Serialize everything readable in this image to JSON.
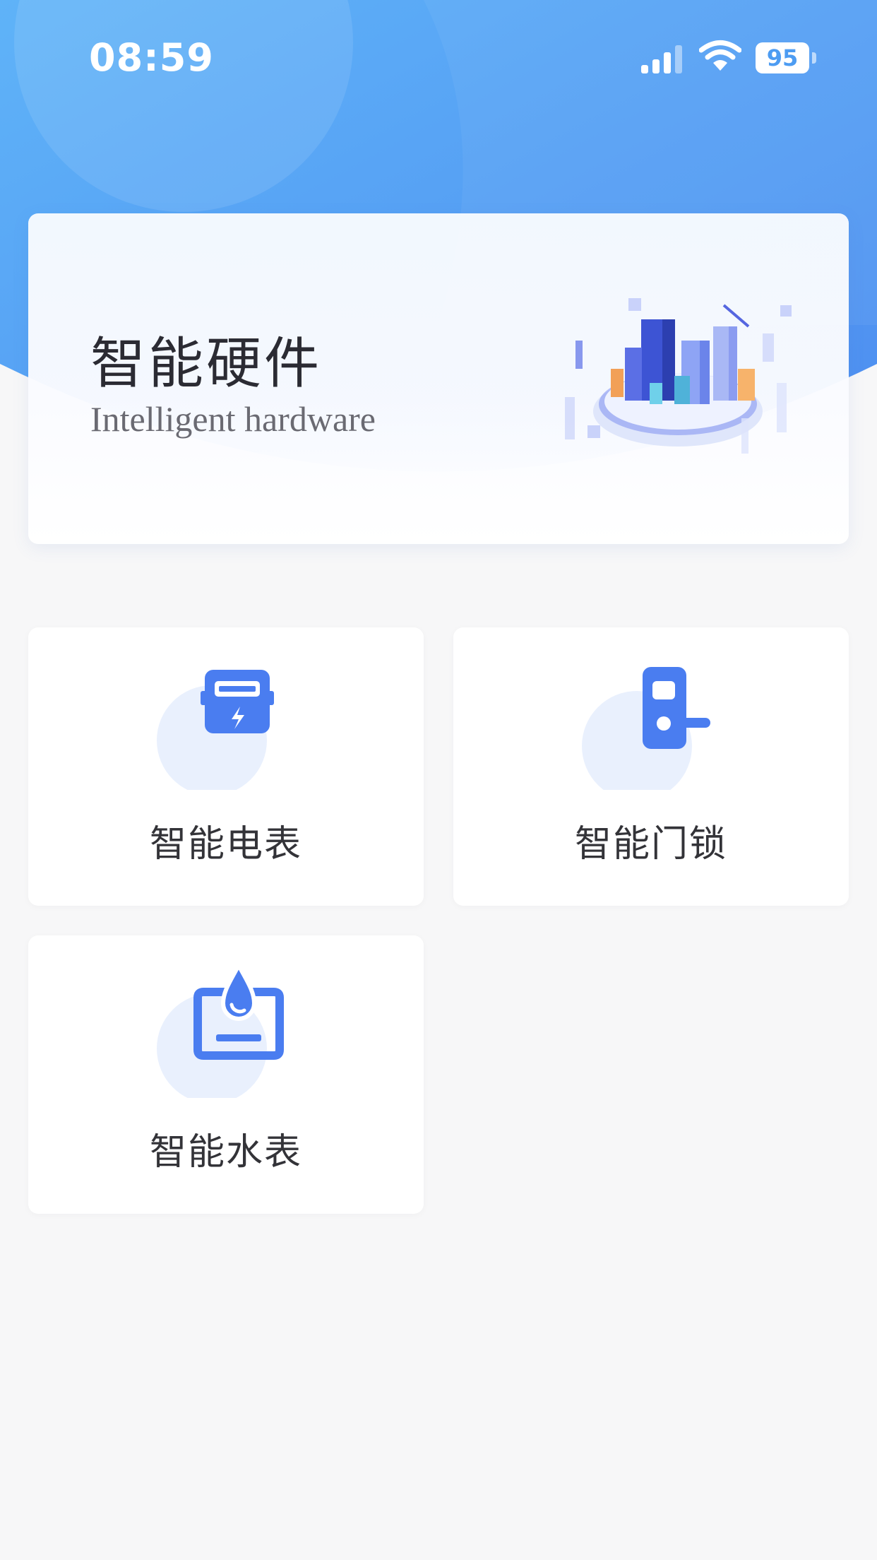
{
  "status_bar": {
    "time": "08:59",
    "battery": "95",
    "signal_icon": "cellular-signal-icon",
    "wifi_icon": "wifi-icon"
  },
  "banner": {
    "title": "智能硬件",
    "subtitle": "Intelligent hardware",
    "illustration": "smart-city-illustration"
  },
  "tiles": [
    {
      "label": "智能电表",
      "icon": "electric-meter-icon"
    },
    {
      "label": "智能门锁",
      "icon": "door-lock-icon"
    },
    {
      "label": "智能水表",
      "icon": "water-meter-icon"
    }
  ],
  "colors": {
    "header_gradient_start": "#5fb0f7",
    "header_gradient_end": "#4f8ff0",
    "accent": "#4a7df0",
    "icon_backdrop": "#e9f0fd",
    "page_background": "#f7f7f8"
  }
}
